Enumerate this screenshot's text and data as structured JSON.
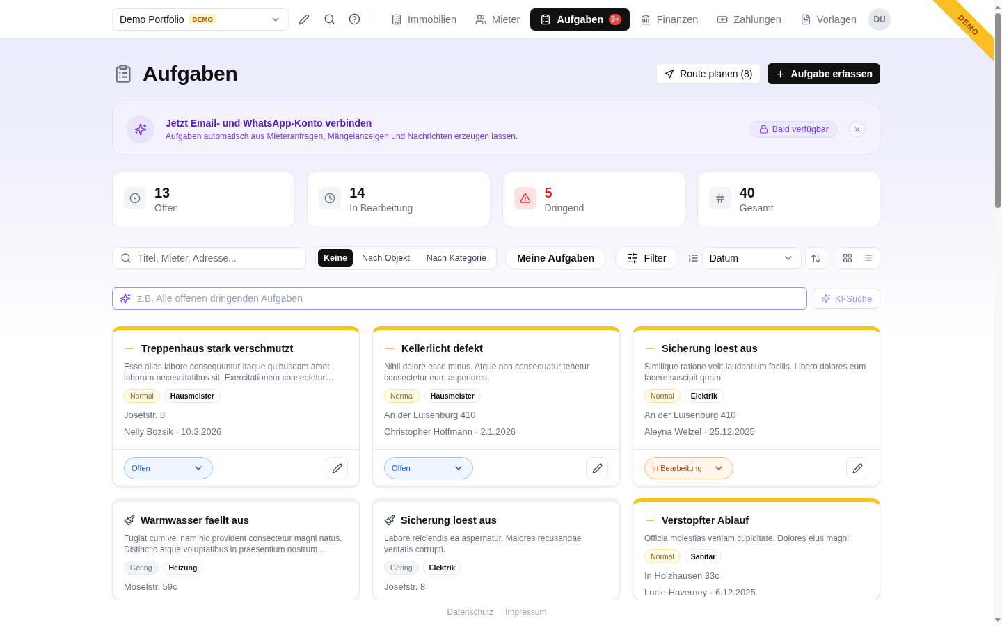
{
  "nav": {
    "portfolio": {
      "value": "Demo Portfolio",
      "badge": "DEMO"
    },
    "items": [
      {
        "label": "Immobilien",
        "selected": false
      },
      {
        "label": "Mieter",
        "selected": false
      },
      {
        "label": "Aufgaben",
        "selected": true,
        "badge": "9+"
      },
      {
        "label": "Finanzen",
        "selected": false
      },
      {
        "label": "Zahlungen",
        "selected": false
      },
      {
        "label": "Vorlagen",
        "selected": false
      }
    ],
    "avatar": "DU"
  },
  "demo_ribbon": {
    "label": "DEMO"
  },
  "header": {
    "title": "Aufgaben",
    "actions": [
      {
        "label": "Route planen (8)",
        "kind": "secondary"
      },
      {
        "label": "Aufgabe erfassen",
        "kind": "primary"
      }
    ]
  },
  "banner": {
    "title": "Jetzt Email- und WhatsApp-Konto verbinden",
    "text": "Aufgaben automatisch aus Mieteranfragen, Mängelanzeigen und Nachrichten erzeugen lassen.",
    "badge": "Bald verfügbar"
  },
  "stats": [
    {
      "value": "13",
      "label": "Offen",
      "kind": "open"
    },
    {
      "value": "14",
      "label": "In Bearbeitung",
      "kind": "in_progress"
    },
    {
      "value": "5",
      "label": "Dringend",
      "kind": "urgent"
    },
    {
      "value": "40",
      "label": "Gesamt",
      "kind": "total"
    }
  ],
  "toolbar": {
    "search": {
      "placeholder": "Titel, Mieter, Adresse..."
    },
    "grouping": [
      {
        "label": "Keine",
        "selected": true
      },
      {
        "label": "Nach Objekt",
        "selected": false
      },
      {
        "label": "Nach Kategorie",
        "selected": false
      }
    ],
    "my_tasks": "Meine Aufgaben",
    "filter": "Filter",
    "sort": {
      "value": "Datum"
    },
    "view": [
      {
        "kind": "grid",
        "selected": true
      },
      {
        "kind": "list",
        "selected": false
      }
    ]
  },
  "ai_search": {
    "placeholder": "z.B. Alle offenen dringenden Aufgaben",
    "button": "KI-Suche"
  },
  "tasks": [
    {
      "title": "Treppenhaus stark verschmutzt",
      "description": "Esse alias labore consequuntur itaque quibusdam amet laborum necessitatibus sit. Exercitationem consectetur…",
      "priority": {
        "label": "Normal",
        "kind": "normal"
      },
      "category": "Hausmeister",
      "address": "Josefstr. 8",
      "meta": "Nelly Bozsik · 10.3.2026",
      "status": {
        "label": "Offen",
        "kind": "open"
      }
    },
    {
      "title": "Kellerlicht defekt",
      "description": "Nihil dolore esse minus. Atque non consequatur tenetur consectetur eum asperiores.",
      "priority": {
        "label": "Normal",
        "kind": "normal"
      },
      "category": "Hausmeister",
      "address": "An der Luisenburg 410",
      "meta": "Christopher Hoffmann · 2.1.2026",
      "status": {
        "label": "Offen",
        "kind": "open"
      }
    },
    {
      "title": "Sicherung loest aus",
      "description": "Similique ratione velit laudantium facilis. Libero dolores eum facere suscipit quam.",
      "priority": {
        "label": "Normal",
        "kind": "normal"
      },
      "category": "Elektrik",
      "address": "An der Luisenburg 410",
      "meta": "Aleyna Welzel · 25.12.2025",
      "status": {
        "label": "In Bearbeitung",
        "kind": "in_progress"
      }
    },
    {
      "title": "Warmwasser faellt aus",
      "description": "Fugiat cum vel nam hic provident consectetur magni natus. Distinctio atque voluptatibus in praesentium nostrum…",
      "priority": {
        "label": "Gering",
        "kind": "low"
      },
      "category": "Heizung",
      "address": "Moselstr. 59c"
    },
    {
      "title": "Sicherung loest aus",
      "description": "Labore reiciendis ea aspernatur. Maiores recusandae veritatis corrupti.",
      "priority": {
        "label": "Gering",
        "kind": "low"
      },
      "category": "Elektrik",
      "address": "Josefstr. 8"
    },
    {
      "title": "Verstopfter Ablauf",
      "description": "Officia molestias veniam cupiditate. Dolores eius magni.",
      "priority": {
        "label": "Normal",
        "kind": "normal"
      },
      "category": "Sanitär",
      "address": "In Holzhausen 33c",
      "meta": "Lucie Haverney · 6.12.2025"
    }
  ],
  "footer": {
    "links": [
      "Datenschutz",
      "Impressum"
    ]
  }
}
